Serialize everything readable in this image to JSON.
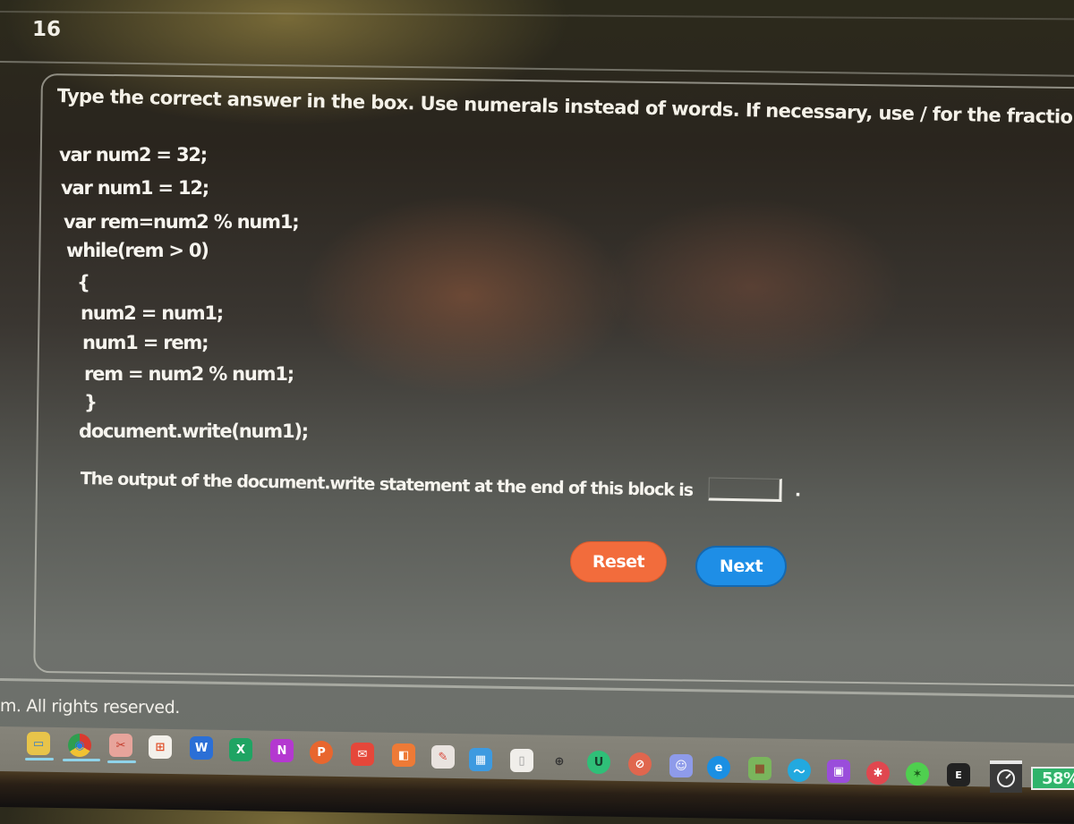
{
  "question": {
    "number": "16",
    "instructions": "Type the correct answer in the box. Use numerals instead of words. If necessary, use / for the fraction bar.",
    "code_lines": [
      "var num2 = 32;",
      "var num1 = 12;",
      "var rem=num2 % num1;",
      "while(rem > 0)",
      "{",
      "num2 = num1;",
      "num1 = rem;",
      "rem = num2 % num1;",
      "}",
      "document.write(num1);"
    ],
    "prompt": "The output of the document.write statement at the end of this block is",
    "answer_value": "",
    "answer_placeholder": "",
    "trailing_punctuation": "."
  },
  "buttons": {
    "reset_label": "Reset",
    "next_label": "Next"
  },
  "colors": {
    "reset": "#f26c3c",
    "next": "#1e8ee6"
  },
  "footer": {
    "copyright": "m. All rights reserved."
  },
  "taskbar": {
    "items": [
      {
        "name": "file-explorer",
        "glyph": "▭"
      },
      {
        "name": "chrome",
        "glyph": "◉"
      },
      {
        "name": "snipping-tool",
        "glyph": "✂"
      },
      {
        "name": "microsoft-store",
        "glyph": "⊞"
      },
      {
        "name": "word",
        "glyph": "W"
      },
      {
        "name": "excel",
        "glyph": "X"
      },
      {
        "name": "onenote",
        "glyph": "N"
      },
      {
        "name": "powerpoint",
        "glyph": "P"
      },
      {
        "name": "mail",
        "glyph": "✉"
      },
      {
        "name": "app-orange",
        "glyph": "◧"
      },
      {
        "name": "paint",
        "glyph": "✎"
      },
      {
        "name": "calendar",
        "glyph": "▦"
      },
      {
        "name": "notepad",
        "glyph": "▯"
      },
      {
        "name": "network-tool",
        "glyph": "⊕"
      },
      {
        "name": "app-green-circle",
        "glyph": "U"
      },
      {
        "name": "app-blocked",
        "glyph": "⊘"
      },
      {
        "name": "discord",
        "glyph": "☺"
      },
      {
        "name": "edge",
        "glyph": "e"
      },
      {
        "name": "minecraft",
        "glyph": "■"
      },
      {
        "name": "app-blue-wave",
        "glyph": "〜"
      },
      {
        "name": "twitch",
        "glyph": "▣"
      },
      {
        "name": "app-red-gear",
        "glyph": "✱"
      },
      {
        "name": "razer",
        "glyph": "✶"
      },
      {
        "name": "epic-games",
        "glyph": "E"
      }
    ],
    "battery_percent": "58%"
  }
}
